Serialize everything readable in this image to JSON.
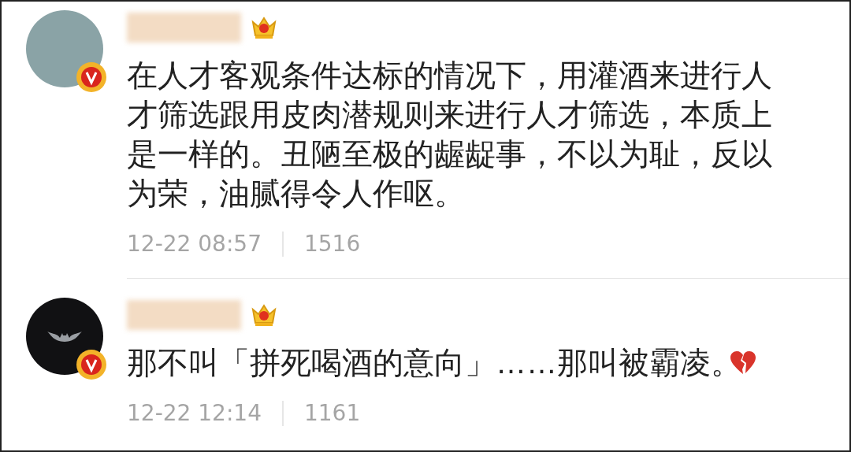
{
  "comments": [
    {
      "kind": "illustration",
      "text": "在人才客观条件达标的情况下，用灌酒来进行人才筛选跟用皮肉潜规则来进行人才筛选，本质上是一样的。丑陋至极的龌龊事，不以为耻，反以为荣，油腻得令人作呕。",
      "emoji": false,
      "time": "12-22 08:57",
      "likes": "1516"
    },
    {
      "kind": "dark",
      "text": "那不叫「拼死喝酒的意向」……那叫被霸凌。",
      "emoji": true,
      "time": "12-22 12:14",
      "likes": "1161"
    }
  ]
}
